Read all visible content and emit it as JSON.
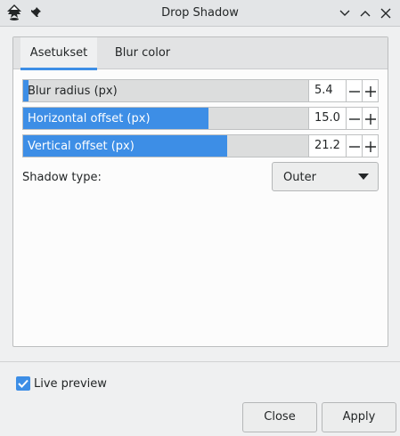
{
  "window": {
    "title": "Drop Shadow"
  },
  "icons": {
    "app": "inkscape-app-icon",
    "pin": "pin-icon",
    "minimize": "chevron-down-icon",
    "maximize": "chevron-up-icon",
    "close": "close-icon",
    "dropdown": "caret-down-icon",
    "check": "checkmark-icon"
  },
  "tabs": [
    {
      "label": "Asetukset",
      "active": true
    },
    {
      "label": "Blur color",
      "active": false
    }
  ],
  "sliders": [
    {
      "label": "Blur radius (px)",
      "value": "5.4",
      "fill": 0.02
    },
    {
      "label": "Horizontal offset (px)",
      "value": "15.0",
      "fill": 0.65
    },
    {
      "label": "Vertical offset (px)",
      "value": "21.2",
      "fill": 0.715
    }
  ],
  "shadow_type": {
    "label": "Shadow type:",
    "value": "Outer"
  },
  "live_preview": {
    "label": "Live preview",
    "checked": true
  },
  "buttons": {
    "close": "Close",
    "apply": "Apply"
  },
  "colors": {
    "accent": "#3d8ee6",
    "window_bg": "#eff0f1",
    "panel_bg": "#fcfcfc",
    "text": "#232627"
  }
}
